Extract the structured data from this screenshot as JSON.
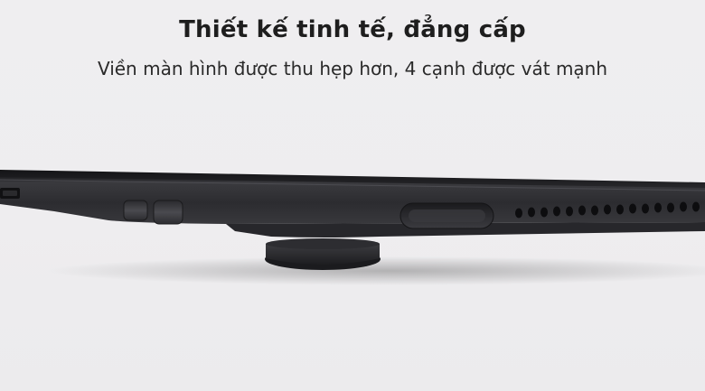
{
  "banner": {
    "headline": "Thiết kế tinh tế, đẳng cấp",
    "subhead": "Viền màn hình được thu hẹp hơn, 4 cạnh được vát mạnh"
  },
  "photo": {
    "subject": "tablet-edge-closeup",
    "colors": {
      "background": "#eeedef",
      "device_body": "#2f2f32",
      "text_dark": "#1e1e1e"
    }
  }
}
